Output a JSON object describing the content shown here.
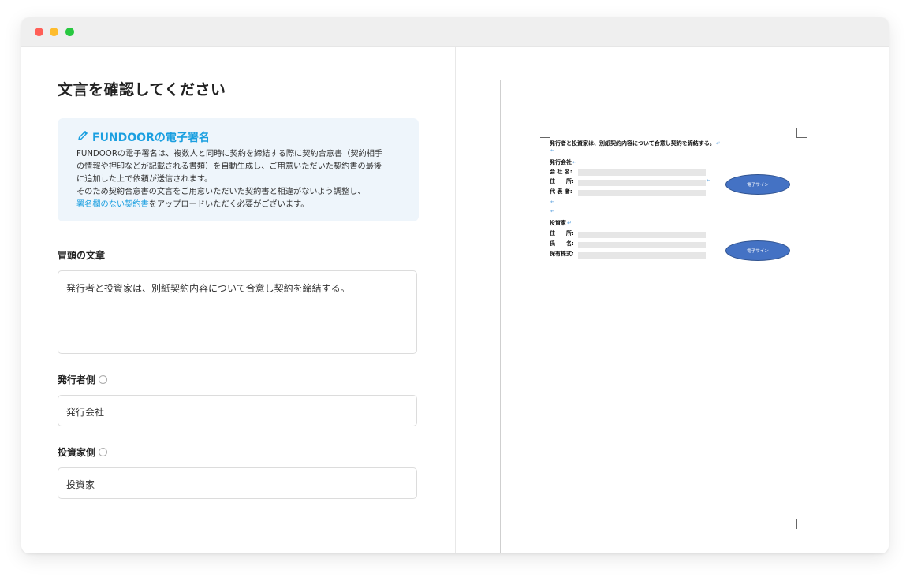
{
  "window": {
    "controls": [
      "close",
      "minimize",
      "maximize"
    ]
  },
  "left": {
    "title": "文言を確認してください",
    "info": {
      "icon": "pencil-icon",
      "title": "FUNDOORの電子署名",
      "line1": "FUNDOORの電子署名は、複数人と同時に契約を締結する際に契約合意書（契約相手",
      "line2": "の情報や押印などが記載される書類）を自動生成し、ご用意いただいた契約書の最後",
      "line3": "に追加した上で依頼が送信されます。",
      "line4": "そのため契約合意書の文言をご用意いただいた契約書と相違がないよう調整し、",
      "link": "署名欄のない契約書",
      "line5_suffix": "をアップロードいただく必要がございます。"
    },
    "opening": {
      "label": "冒頭の文章",
      "value": "発行者と投資家は、別紙契約内容について合意し契約を締結する。"
    },
    "issuer": {
      "label": "発行者側",
      "value": "発行会社"
    },
    "investor": {
      "label": "投資家側",
      "value": "投資家"
    },
    "info_icon_glyph": "i"
  },
  "preview": {
    "heading": "発行者と投資家は、別紙契約内容について合意し契約を締結する。",
    "return_mark": "↵",
    "issuer_section": "発行会社",
    "issuer_fields": [
      "会 社 名:",
      "住　　所:",
      "代 表 者:"
    ],
    "investor_section": "投資家",
    "investor_fields": [
      "住　　所:",
      "氏　　名:",
      "保有株式:"
    ],
    "sign_label": "電子サイン"
  },
  "colors": {
    "accent": "#1a9fe0",
    "info_bg": "#eef5fb",
    "sign_button": "#4472c4"
  }
}
